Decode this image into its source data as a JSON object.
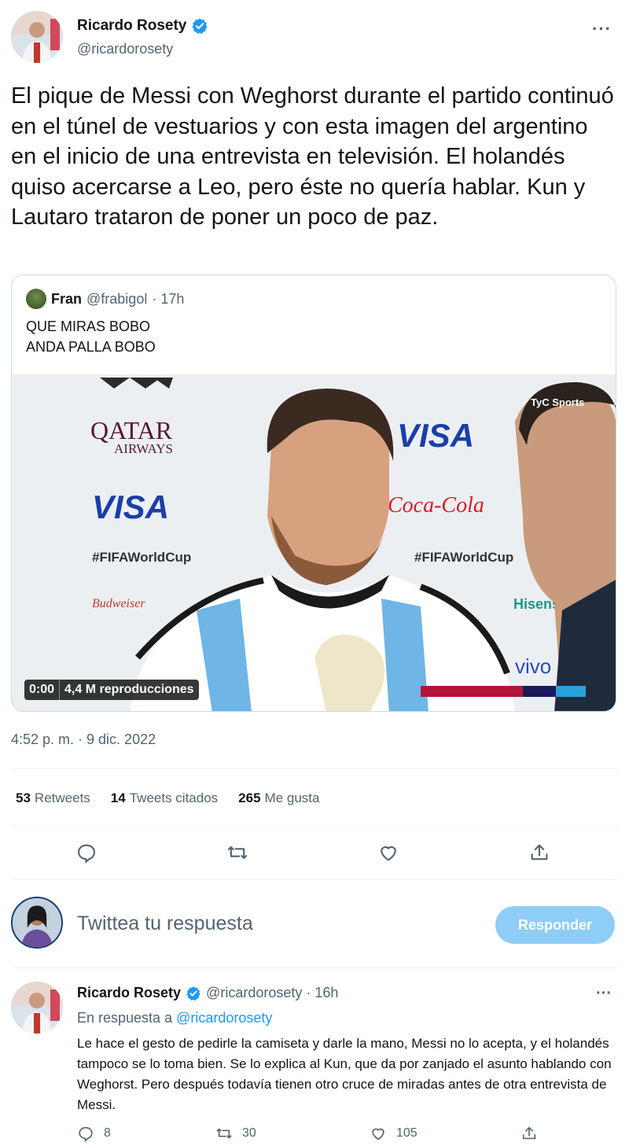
{
  "tweet": {
    "author_name": "Ricardo Rosety",
    "author_handle": "@ricardorosety",
    "more": "···",
    "text": "El pique de Messi con Weghorst durante el partido continuó en el túnel de vestuarios y con esta imagen del argentino en el inicio de una entrevista en televisión. El holandés quiso acercarse a Leo, pero éste no quería hablar. Kun y Lautaro trataron de poner un poco de paz.",
    "timestamp": "4:52 p. m. · 9 dic. 2022"
  },
  "quote": {
    "name": "Fran",
    "handle": "@frabigol",
    "time": "· 17h",
    "text": "QUE MIRAS BOBO\nANDA PALLA BOBO",
    "video_time": "0:00",
    "video_views": "4,4 M reproducciones",
    "media_texts": {
      "qatar": "QATAR",
      "airways": "AIRWAYS",
      "visa": "VISA",
      "hashtag": "#FIFAWorldCup",
      "budweiser": "Budweiser",
      "hisense": "Hisense",
      "cocacola": "Coca-Cola",
      "tyc": "TyC Sports",
      "vivo": "vivo"
    }
  },
  "stats": [
    {
      "count": "53",
      "label": "Retweets"
    },
    {
      "count": "14",
      "label": "Tweets citados"
    },
    {
      "count": "265",
      "label": "Me gusta"
    }
  ],
  "actions": [
    "reply-icon",
    "retweet-icon",
    "like-icon",
    "share-icon"
  ],
  "reply_box": {
    "placeholder": "Twittea tu respuesta",
    "button": "Responder"
  },
  "second_tweet": {
    "author_name": "Ricardo Rosety",
    "handle_time": "@ricardorosety · 16h",
    "more": "···",
    "replying_prefix": "En respuesta a",
    "replying_to": "@ricardorosety",
    "text": "Le hace el gesto de pedirle la camiseta y darle la mano, Messi no lo acepta, y el holandés tampoco se lo toma bien. Se lo explica al Kun, que da por zanjado el asunto hablando con Weghorst. Pero después todavía tienen otro cruce de miradas antes de otra entrevista de Messi.",
    "replies": "8",
    "retweets": "30",
    "likes": "105"
  },
  "colors": {
    "accent": "#1d9bf0",
    "button_disabled": "#8ecdf7",
    "secondary_text": "#536471"
  }
}
